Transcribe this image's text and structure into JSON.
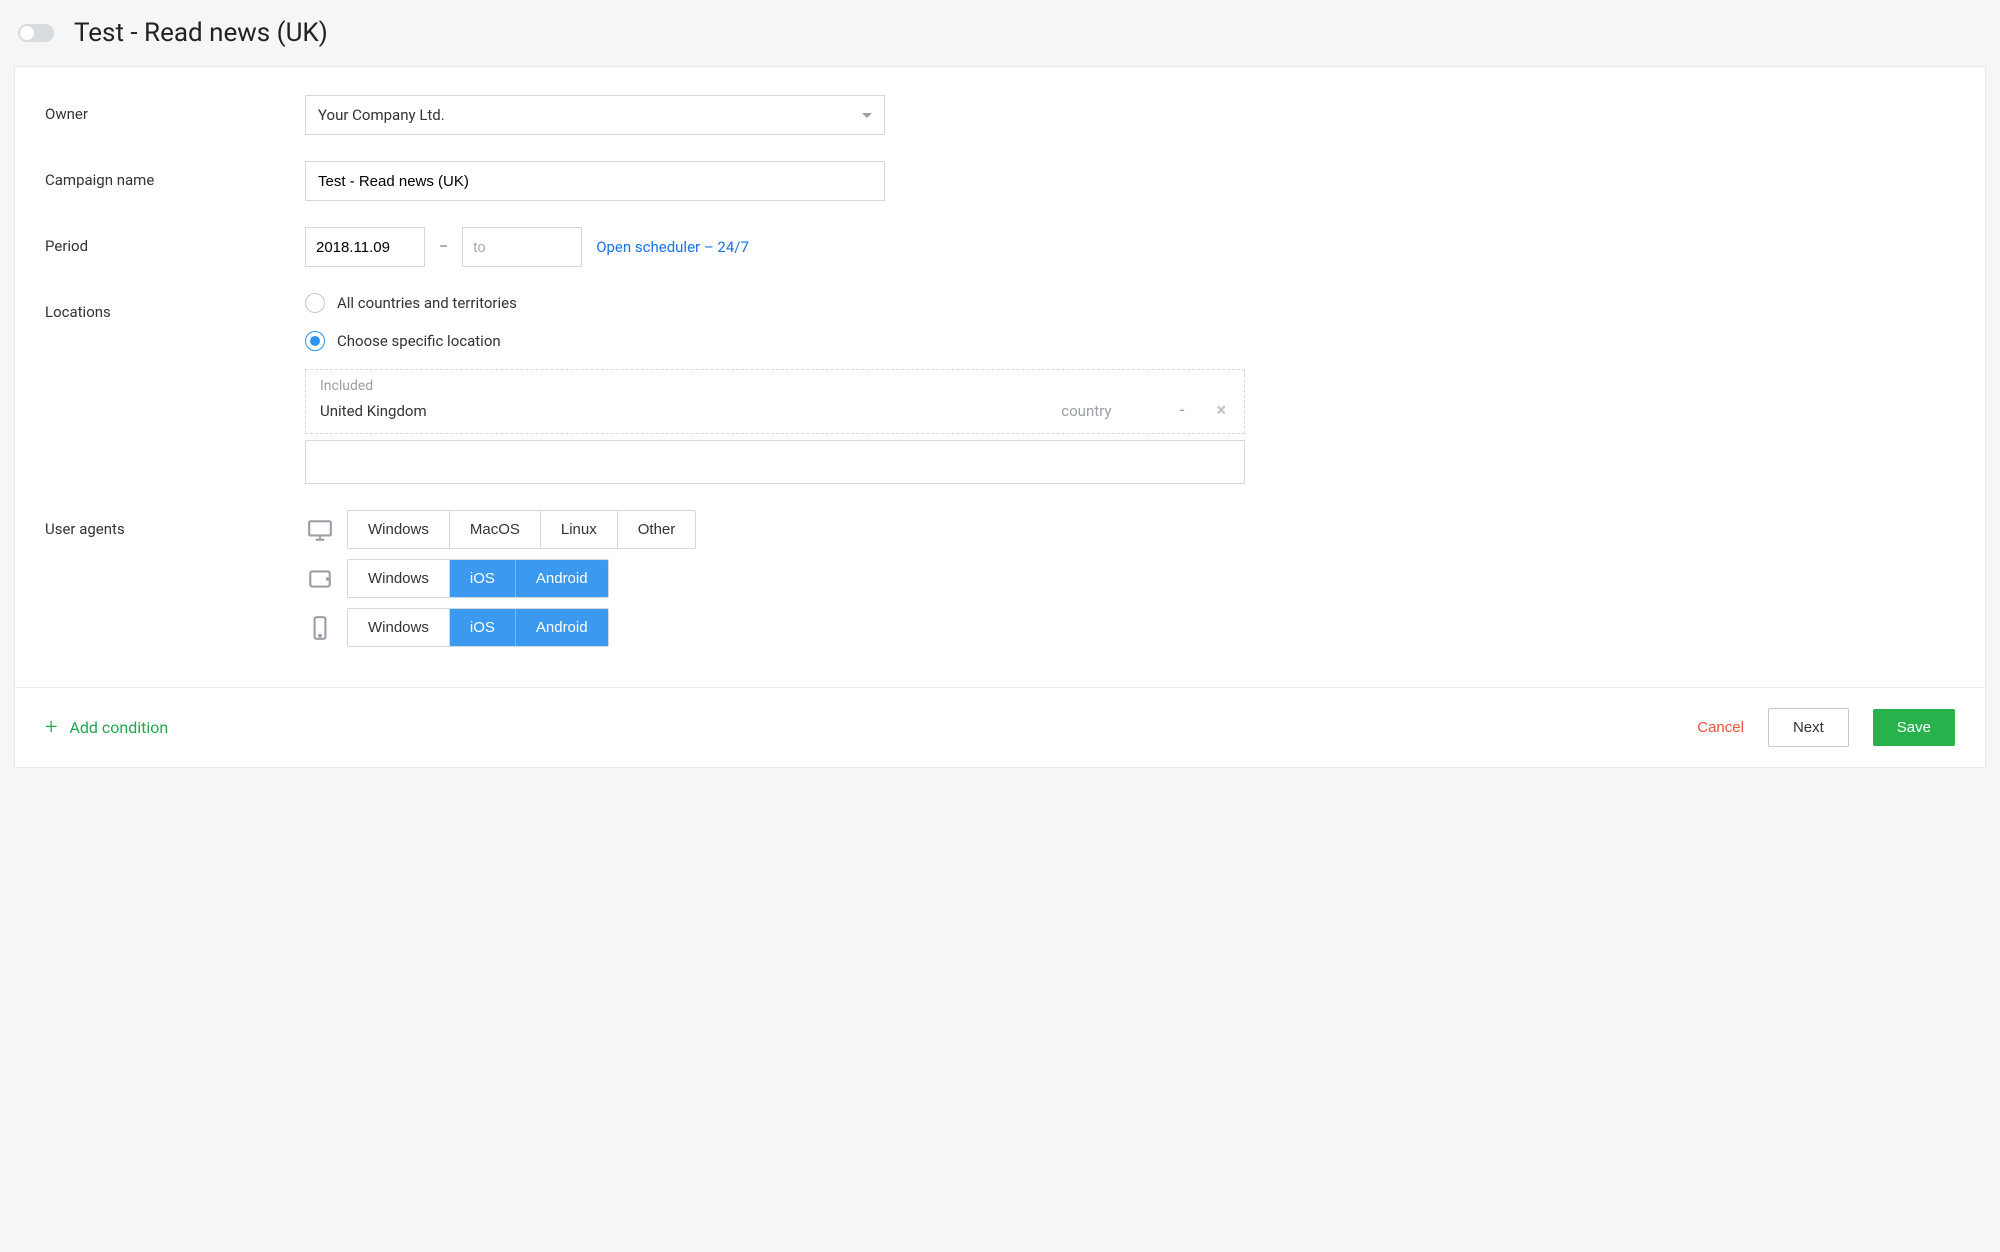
{
  "header": {
    "title": "Test - Read news (UK)"
  },
  "form": {
    "owner_label": "Owner",
    "owner_value": "Your Company Ltd.",
    "campaign_label": "Campaign name",
    "campaign_value": "Test - Read news (UK)",
    "period_label": "Period",
    "period_from": "2018.11.09",
    "period_to_placeholder": "to",
    "period_dash": "–",
    "scheduler_link": "Open scheduler – 24/7",
    "locations_label": "Locations",
    "loc_all": "All countries and territories",
    "loc_specific": "Choose specific location",
    "included_title": "Included",
    "included_item": {
      "name": "United Kingdom",
      "type": "country",
      "minus": "-",
      "remove": "×"
    },
    "ua_label": "User agents",
    "ua_rows": [
      {
        "device": "desktop",
        "options": [
          "Windows",
          "MacOS",
          "Linux",
          "Other"
        ],
        "selected": []
      },
      {
        "device": "tablet",
        "options": [
          "Windows",
          "iOS",
          "Android"
        ],
        "selected": [
          "iOS",
          "Android"
        ]
      },
      {
        "device": "mobile",
        "options": [
          "Windows",
          "iOS",
          "Android"
        ],
        "selected": [
          "iOS",
          "Android"
        ]
      }
    ]
  },
  "footer": {
    "add_condition": "Add condition",
    "cancel": "Cancel",
    "next": "Next",
    "save": "Save"
  }
}
